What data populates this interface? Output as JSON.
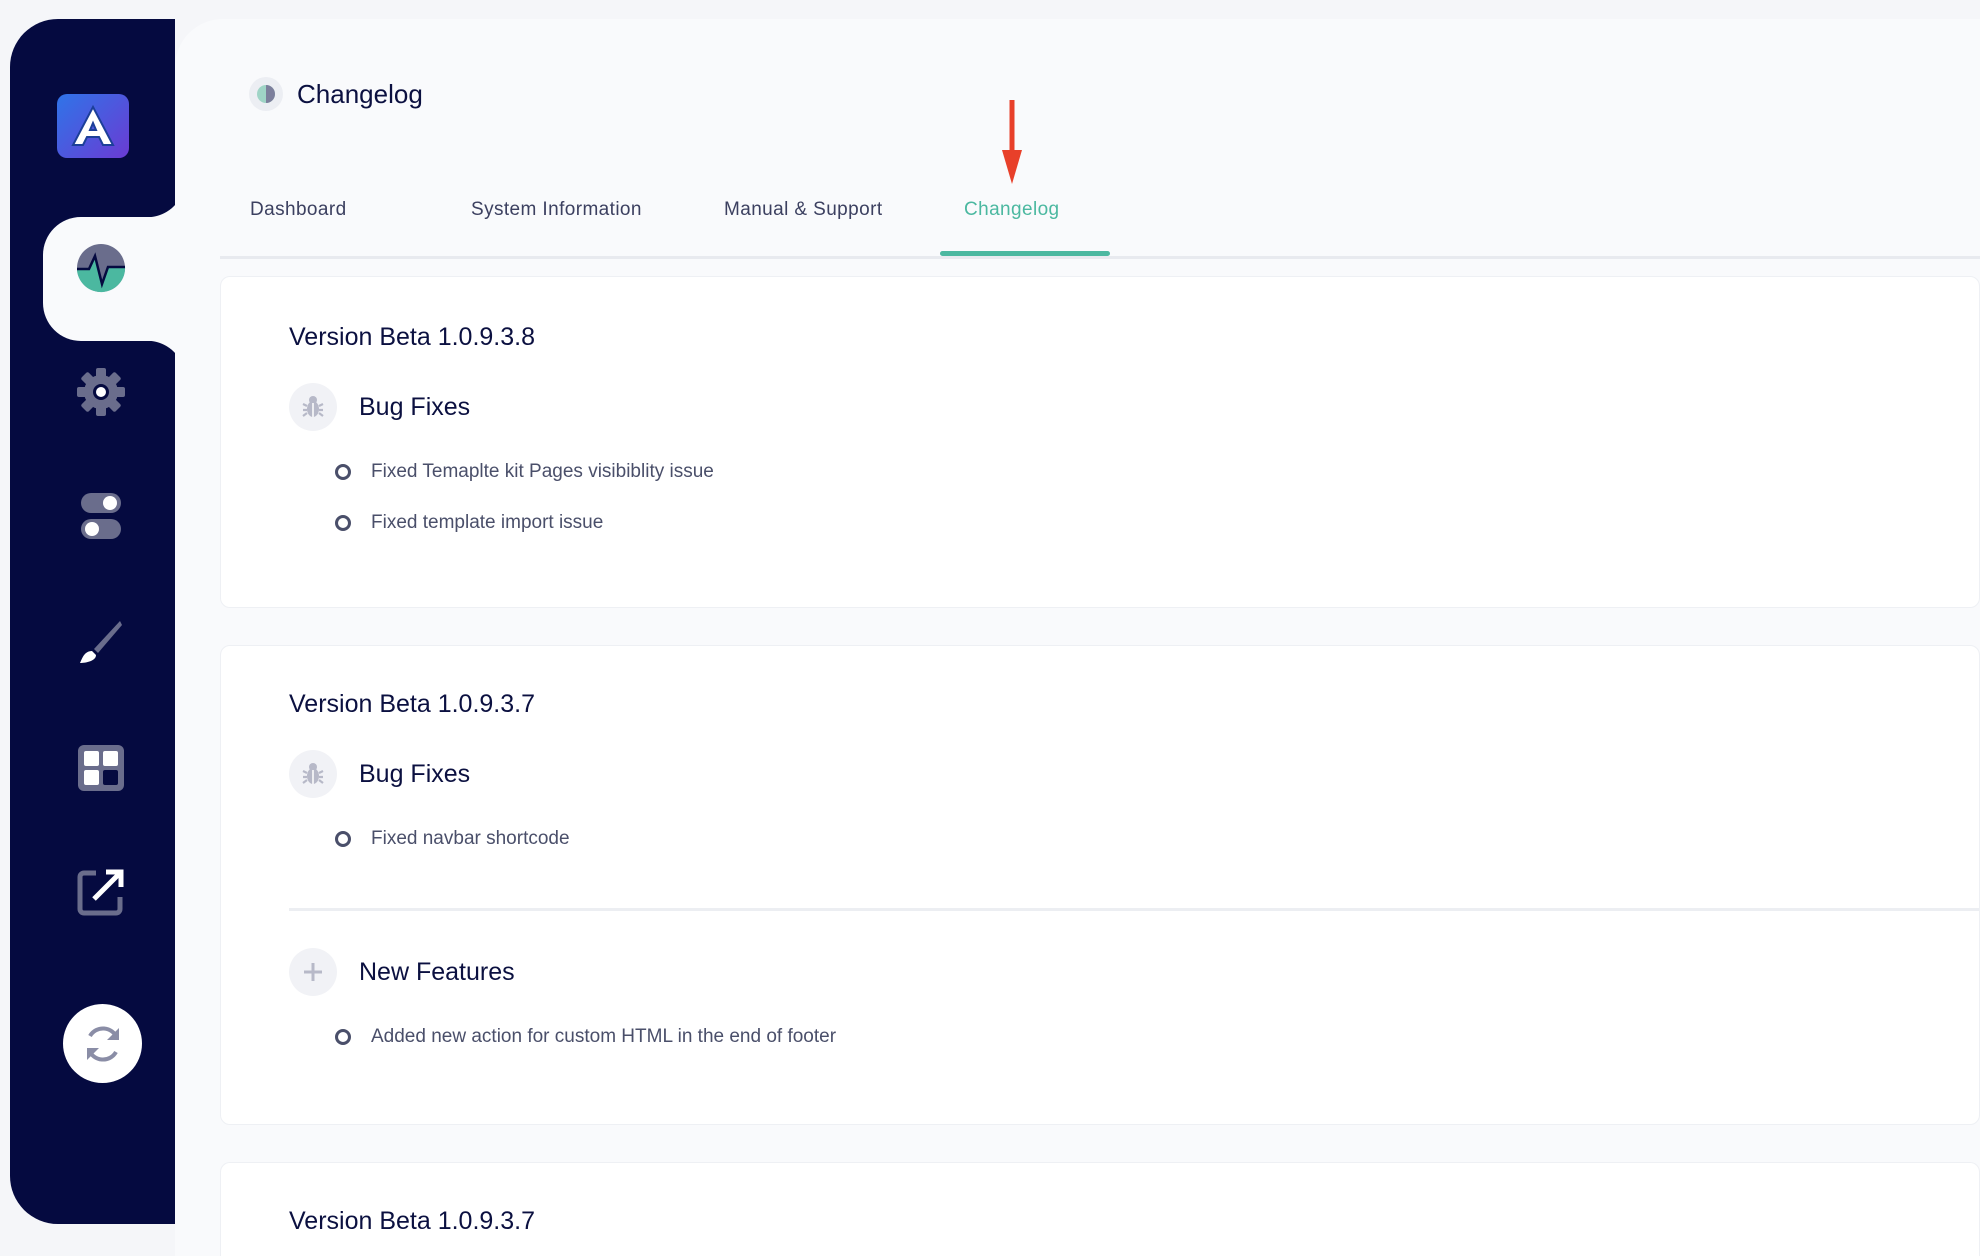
{
  "header": {
    "title": "Changelog"
  },
  "tabs": [
    {
      "label": "Dashboard"
    },
    {
      "label": "System Information"
    },
    {
      "label": "Manual & Support"
    },
    {
      "label": "Changelog"
    }
  ],
  "active_tab": "Changelog",
  "colors": {
    "sidebar": "#050a40",
    "accent": "#4bb8a0",
    "arrow": "#e8402a"
  },
  "changelog": [
    {
      "version": "Version Beta 1.0.9.3.8",
      "sections": [
        {
          "title": "Bug Fixes",
          "icon": "bug-icon",
          "items": [
            "Fixed Temaplte kit Pages visibiblity issue",
            "Fixed template import issue"
          ]
        }
      ]
    },
    {
      "version": "Version Beta 1.0.9.3.7",
      "sections": [
        {
          "title": "Bug Fixes",
          "icon": "bug-icon",
          "items": [
            "Fixed navbar shortcode"
          ]
        },
        {
          "title": "New Features",
          "icon": "plus-icon",
          "items": [
            "Added new action for custom HTML in the end of footer"
          ]
        }
      ]
    },
    {
      "version": "Version Beta 1.0.9.3.7",
      "sections": []
    }
  ]
}
